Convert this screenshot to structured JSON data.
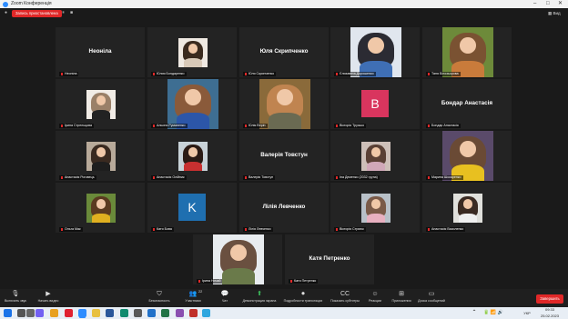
{
  "window": {
    "title": "Zoom Конференція",
    "icon": "zoom-logo-icon"
  },
  "topbar": {
    "share_label": "Запись приостановлена",
    "view_label": "Вид"
  },
  "tiles": [
    {
      "label": "Неоніла",
      "display_name": "Неоніла",
      "type": "name"
    },
    {
      "label": "Юлия Бондаренко",
      "type": "photo",
      "colors": [
        "#3a2a1e",
        "#efe9e2",
        "#d8c9b8"
      ]
    },
    {
      "label": "Юля Скрипченко",
      "display_name": "Юля Скрипченко",
      "type": "name"
    },
    {
      "label": "Єлизавета Дорошенко",
      "type": "photo",
      "colors": [
        "#2b2b33",
        "#e0e6ee",
        "#3f6fb5"
      ]
    },
    {
      "label": "Таня Білозьорова",
      "type": "photo",
      "colors": [
        "#7a5232",
        "#6d8a3a",
        "#c97b3b"
      ]
    },
    {
      "label": "Ірина Стрельцова",
      "type": "photo",
      "colors": [
        "#9a8068",
        "#f1ece6",
        "#222222"
      ]
    },
    {
      "label": "Альона Руманенко",
      "type": "photo",
      "colors": [
        "#8a5a3a",
        "#3e6e92",
        "#2c56a8"
      ]
    },
    {
      "label": "Юлія Верін",
      "type": "photo",
      "colors": [
        "#c08450",
        "#8a6a3a",
        "#6a6a52"
      ]
    },
    {
      "label": "Вікторія Трузько",
      "type": "avatar",
      "letter": "B",
      "color": "#d9355e"
    },
    {
      "label": "Бондар Анастасія",
      "display_name": "Бондар Анастасія",
      "type": "name"
    },
    {
      "label": "Анастасія Роговець",
      "type": "photo",
      "colors": [
        "#3a2a20",
        "#b8aa9a",
        "#1e1e1e"
      ]
    },
    {
      "label": "Анастасія Олійник",
      "type": "photo",
      "colors": [
        "#2a1a14",
        "#c8d2d8",
        "#c83030"
      ]
    },
    {
      "label": "Валерія Товстун",
      "display_name": "Валерія Товстун",
      "type": "name"
    },
    {
      "label": "Іна Деменко (2032 група)",
      "type": "photo",
      "colors": [
        "#5a4035",
        "#cdbfb8",
        "#d0a8b8"
      ]
    },
    {
      "label": "Марина Шкоаренко",
      "type": "photo",
      "colors": [
        "#6a4a35",
        "#5a4a6a",
        "#e8c020"
      ]
    },
    {
      "label": "Ольга Мак",
      "type": "photo",
      "colors": [
        "#5a3a20",
        "#6a8a3a",
        "#e0b020"
      ]
    },
    {
      "label": "Катя Бова",
      "type": "avatar",
      "letter": "K",
      "color": "#1f6fb0"
    },
    {
      "label": "Лілія Левченко",
      "display_name": "Лілія Левченко",
      "type": "name"
    },
    {
      "label": "Вікторія Стриюк",
      "type": "photo",
      "colors": [
        "#7a5a48",
        "#b8c0c8",
        "#e8b0c0"
      ]
    },
    {
      "label": "Анастасія Василенко",
      "type": "photo",
      "colors": [
        "#3a2a22",
        "#e0e0dc",
        "#f0f0f0"
      ]
    },
    {
      "label": "Ірина Ничай",
      "type": "photo",
      "colors": [
        "#6a5040",
        "#e8ecef",
        "#6a7a4a"
      ]
    },
    {
      "label": "Катя Петренко",
      "display_name": "Катя Петренко",
      "type": "name"
    }
  ],
  "toolbar": [
    {
      "label": "Включить звук",
      "icon": "mic-muted-icon",
      "glyph": "🎙"
    },
    {
      "label": "Начать видео",
      "icon": "video-off-icon",
      "glyph": "▶"
    },
    {
      "label": "Безопасность",
      "icon": "shield-icon",
      "glyph": "⛉"
    },
    {
      "label": "Участники",
      "icon": "participants-icon",
      "glyph": "👥",
      "badge": "22"
    },
    {
      "label": "Чат",
      "icon": "chat-icon",
      "glyph": "💬"
    },
    {
      "label": "Демонстрация экрана",
      "icon": "share-screen-icon",
      "glyph": "⬆"
    },
    {
      "label": "Подробности трансляции",
      "icon": "record-icon",
      "glyph": "⏺"
    },
    {
      "label": "Показать субтитры",
      "icon": "cc-icon",
      "glyph": "CC"
    },
    {
      "label": "Реакции",
      "icon": "reactions-icon",
      "glyph": "☺"
    },
    {
      "label": "Приложения",
      "icon": "apps-icon",
      "glyph": "⊞"
    },
    {
      "label": "Доска сообщений",
      "icon": "whiteboard-icon",
      "glyph": "▭"
    }
  ],
  "end_button": "Завершить",
  "taskbar": {
    "icons": [
      {
        "name": "windows-start-icon",
        "color": "#1a73e8"
      },
      {
        "name": "search-icon",
        "color": "#555555"
      },
      {
        "name": "taskview-icon",
        "color": "#666666"
      },
      {
        "name": "viber-icon",
        "color": "#7360f2"
      },
      {
        "name": "chrome-icon",
        "color": "#e8a020"
      },
      {
        "name": "opera-icon",
        "color": "#e02030"
      },
      {
        "name": "zoom-icon",
        "color": "#2d8cff"
      },
      {
        "name": "explorer-icon",
        "color": "#e8c040"
      },
      {
        "name": "word-icon",
        "color": "#2b579a"
      },
      {
        "name": "edge-icon",
        "color": "#0f8a6e"
      },
      {
        "name": "store-icon",
        "color": "#5a5a5a"
      },
      {
        "name": "mail-icon",
        "color": "#2272c9"
      },
      {
        "name": "excel-icon",
        "color": "#217346"
      },
      {
        "name": "photos-icon",
        "color": "#8a4fb0"
      },
      {
        "name": "pdf-icon",
        "color": "#c0302a"
      },
      {
        "name": "telegram-icon",
        "color": "#2ea6df"
      }
    ],
    "lang": "УКР",
    "time": "09:33",
    "date": "25.02.2023"
  }
}
